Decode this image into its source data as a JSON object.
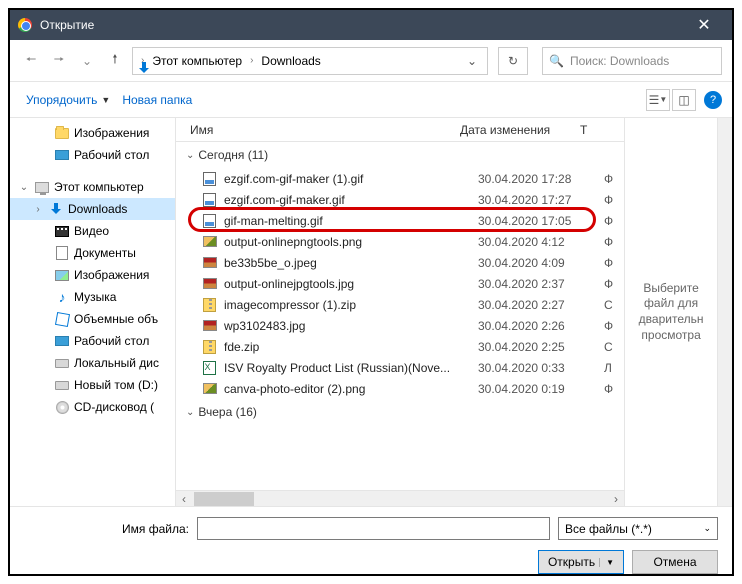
{
  "titlebar": {
    "title": "Открытие",
    "close": "✕"
  },
  "nav": {
    "crumb_pc": "Этот компьютер",
    "crumb_folder": "Downloads",
    "search_placeholder": "Поиск: Downloads"
  },
  "toolbar": {
    "organize": "Упорядочить",
    "new_folder": "Новая папка",
    "help": "?"
  },
  "columns": {
    "name": "Имя",
    "date": "Дата изменения",
    "type": "Т"
  },
  "sidebar": {
    "items": [
      {
        "label": "Изображения",
        "icon": "folder",
        "indent": 28
      },
      {
        "label": "Рабочий стол",
        "icon": "desktop",
        "indent": 28
      },
      {
        "label": "Этот компьютер",
        "icon": "pc",
        "indent": 8,
        "exp": "⌄"
      },
      {
        "label": "Downloads",
        "icon": "down",
        "indent": 22,
        "exp": "›",
        "selected": true
      },
      {
        "label": "Видео",
        "icon": "video",
        "indent": 28
      },
      {
        "label": "Документы",
        "icon": "doc",
        "indent": 28
      },
      {
        "label": "Изображения",
        "icon": "img",
        "indent": 28
      },
      {
        "label": "Музыка",
        "icon": "music",
        "indent": 28
      },
      {
        "label": "Объемные объ",
        "icon": "3d",
        "indent": 28
      },
      {
        "label": "Рабочий стол",
        "icon": "desktop",
        "indent": 28
      },
      {
        "label": "Локальный дис",
        "icon": "drive",
        "indent": 28
      },
      {
        "label": "Новый том (D:)",
        "icon": "drive",
        "indent": 28
      },
      {
        "label": "CD-дисковод (",
        "icon": "cd",
        "indent": 28
      }
    ]
  },
  "groups": [
    {
      "header": "Сегодня (11)",
      "files": [
        {
          "name": "ezgif.com-gif-maker (1).gif",
          "date": "30.04.2020 17:28",
          "type": "Ф",
          "icon": "gif"
        },
        {
          "name": "ezgif.com-gif-maker.gif",
          "date": "30.04.2020 17:27",
          "type": "Ф",
          "icon": "gif"
        },
        {
          "name": "gif-man-melting.gif",
          "date": "30.04.2020 17:05",
          "type": "Ф",
          "icon": "gif",
          "highlight": true
        },
        {
          "name": "output-onlinepngtools.png",
          "date": "30.04.2020 4:12",
          "type": "Ф",
          "icon": "png"
        },
        {
          "name": "be33b5be_o.jpeg",
          "date": "30.04.2020 4:09",
          "type": "Ф",
          "icon": "jpg"
        },
        {
          "name": "output-onlinejpgtools.jpg",
          "date": "30.04.2020 2:37",
          "type": "Ф",
          "icon": "jpg"
        },
        {
          "name": "imagecompressor (1).zip",
          "date": "30.04.2020 2:27",
          "type": "С",
          "icon": "zip"
        },
        {
          "name": "wp3102483.jpg",
          "date": "30.04.2020 2:26",
          "type": "Ф",
          "icon": "jpg"
        },
        {
          "name": "fde.zip",
          "date": "30.04.2020 2:25",
          "type": "С",
          "icon": "zip"
        },
        {
          "name": "ISV Royalty Product List (Russian)(Nove...",
          "date": "30.04.2020 0:33",
          "type": "Л",
          "icon": "xls"
        },
        {
          "name": "canva-photo-editor (2).png",
          "date": "30.04.2020 0:19",
          "type": "Ф",
          "icon": "png"
        }
      ]
    },
    {
      "header": "Вчера (16)",
      "files": []
    }
  ],
  "preview": {
    "text": "Выберите файл для дварительн просмотра"
  },
  "bottom": {
    "filename_label": "Имя файла:",
    "filename_value": "",
    "filter": "Все файлы (*.*)",
    "open": "Открыть",
    "cancel": "Отмена"
  }
}
